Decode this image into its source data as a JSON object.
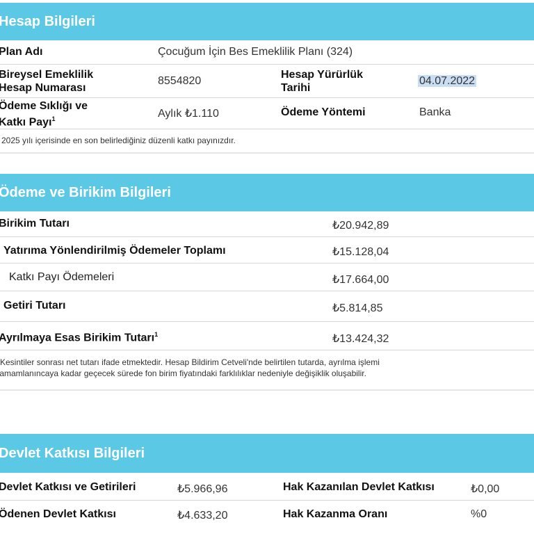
{
  "hesap": {
    "title": "Hesap Bilgileri",
    "plan_label": "Plan Adı",
    "plan_value": "Çocuğum İçin Bes Emeklilik Planı (324)",
    "bireysel_label_1": "Bireysel Emeklilik",
    "bireysel_label_2": "Hesap Numarası",
    "bireysel_value": "8554820",
    "yururluk_label_1": "Hesap Yürürlük",
    "yururluk_label_2": "Tarihi",
    "yururluk_value": "04.07.2022",
    "siklik_label_1": "Ödeme Sıklığı ve",
    "siklik_label_2": "Katkı Payı",
    "siklik_sup": "1",
    "siklik_value": "Aylık ₺1.110",
    "yontem_label": "Ödeme Yöntemi",
    "yontem_value": "Banka",
    "footnote": "2025 yılı içerisinde en son belirlediğiniz düzenli katkı payınızdır."
  },
  "odeme": {
    "title": "Ödeme ve Birikim Bilgileri",
    "rows": [
      {
        "label": "Birikim Tutarı",
        "value": "₺20.942,89"
      },
      {
        "label": "Yatırıma Yönlendirilmiş Ödemeler Toplamı",
        "value": "₺15.128,04"
      },
      {
        "label": "Katkı Payı Ödemeleri",
        "value": "₺17.664,00"
      },
      {
        "label": "Getiri Tutarı",
        "value": "₺5.814,85"
      },
      {
        "label": "Ayrılmaya Esas Birikim Tutarı",
        "sup": "1",
        "value": "₺13.424,32"
      }
    ],
    "footnote_1": "Kesintiler sonrası net tutarı ifade etmektedir. Hesap Bildirim Cetveli'nde belirtilen tutarda, ayrılma işlemi",
    "footnote_2": "tamamlanıncaya kadar geçecek sürede fon birim fiyatındaki farklılıklar nedeniyle değişiklik oluşabilir."
  },
  "devlet": {
    "title": "Devlet Katkısı Bilgileri",
    "katki_label": "Devlet Katkısı ve Getirileri",
    "katki_value": "₺5.966,96",
    "hak_label": "Hak Kazanılan Devlet Katkısı",
    "hak_value": "₺0,00",
    "odenen_label": "Ödenen Devlet Katkısı",
    "odenen_value": "₺4.633,20",
    "oran_label": "Hak Kazanma Oranı",
    "oran_value": "%0"
  }
}
